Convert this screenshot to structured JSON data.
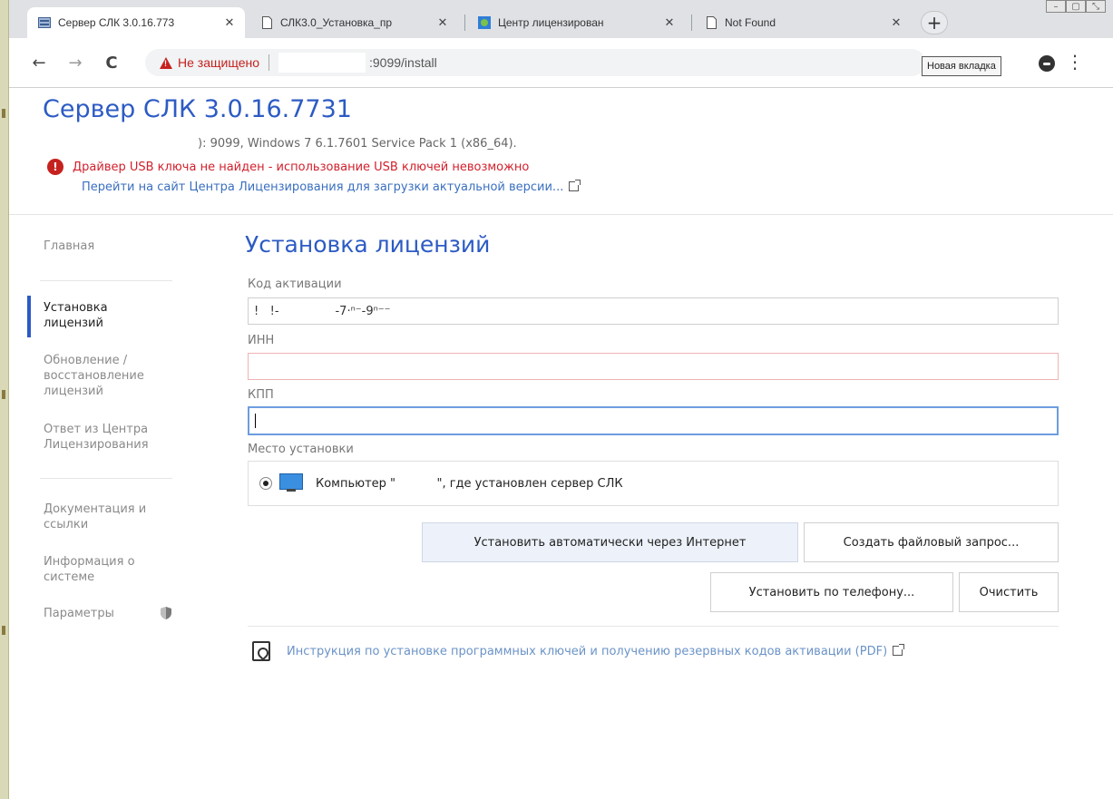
{
  "browser": {
    "tabs": [
      {
        "title": "Сервер СЛК 3.0.16.773",
        "icon": "server-app-icon",
        "active": true
      },
      {
        "title": "СЛК3.0_Установка_пр",
        "icon": "page-icon"
      },
      {
        "title": "Центр лицензирован",
        "icon": "license-center-icon"
      },
      {
        "title": "Not Found",
        "icon": "page-icon"
      }
    ],
    "new_tab_symbol": "+",
    "window_buttons": [
      "–",
      "▢",
      "⤡"
    ],
    "nav": {
      "back": "←",
      "forward": "→",
      "reload": "C"
    },
    "security_text": "Не защищено",
    "url": ":9099/install",
    "new_tab_button": "Новая вкладка",
    "menu_symbol": "⋮"
  },
  "header": {
    "title": "Сервер СЛК 3.0.16.7731",
    "server_info": "): 9099,  Windows 7 6.1.7601 Service Pack 1 (x86_64).",
    "error_text": "Драйвер USB ключа не найден - использование USB ключей невозможно",
    "download_link": "Перейти на сайт Центра Лицензирования для загрузки актуальной версии..."
  },
  "sidebar": {
    "home": "Главная",
    "install": "Установка лицензий",
    "update": "Обновление / восстановление лицензий",
    "response": "Ответ из Центра Лицензирования",
    "docs": "Документация и ссылки",
    "sysinfo": "Информация о системе",
    "params": "Параметры"
  },
  "main": {
    "title": "Установка лицензий",
    "activation_label": "Код активации",
    "activation_value": "!   !-               -7·ⁿ⁻-9ⁿ⁻⁻",
    "inn_label": "ИНН",
    "inn_value": "",
    "kpp_label": "КПП",
    "kpp_value": "",
    "place_label": "Место установки",
    "place_option": "Компьютер \"           \", где установлен сервер СЛК",
    "btn_auto": "Установить автоматически через Интернет",
    "btn_file": "Создать файловый запрос...",
    "btn_phone": "Установить по телефону...",
    "btn_clear": "Очистить",
    "pdf_link": "Инструкция по установке программных ключей и получению резервных кодов активации (PDF)"
  },
  "colors": {
    "accent": "#2d5bc4",
    "error": "#d2202c",
    "link": "#3a6fbf"
  }
}
